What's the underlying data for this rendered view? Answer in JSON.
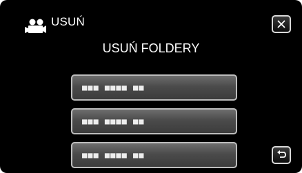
{
  "header": {
    "title": "USUŃ",
    "mode_icon": "movie-camera-icon"
  },
  "subtitle": "USUŃ FOLDERY",
  "folders": [
    {
      "label": "■■■ ■■■■ ■■"
    },
    {
      "label": "■■■ ■■■■ ■■"
    },
    {
      "label": "■■■ ■■■■ ■■"
    }
  ],
  "buttons": {
    "close_icon": "close-icon",
    "back_icon": "back-return-icon"
  },
  "colors": {
    "background": "#000000",
    "text": "#ffffff",
    "button_border": "#bdbdbd"
  }
}
